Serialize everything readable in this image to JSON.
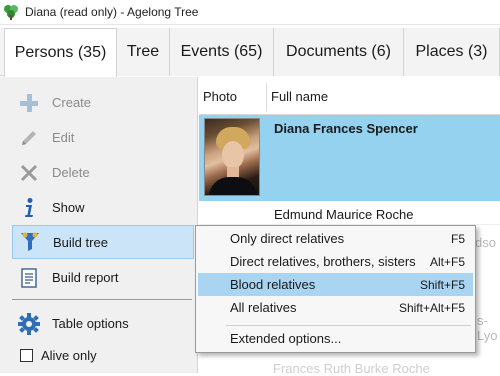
{
  "window": {
    "title": "Diana (read only) - Agelong Tree",
    "icon": "app-tree-icon"
  },
  "tabs": [
    {
      "label": "Persons (35)",
      "active": true
    },
    {
      "label": "Tree"
    },
    {
      "label": "Events (65)"
    },
    {
      "label": "Documents (6)"
    },
    {
      "label": "Places (3)"
    }
  ],
  "sidebar": {
    "items": [
      {
        "label": "Create",
        "icon": "plus-icon",
        "enabled": false
      },
      {
        "label": "Edit",
        "icon": "pencil-icon",
        "enabled": false
      },
      {
        "label": "Delete",
        "icon": "cross-icon",
        "enabled": false
      },
      {
        "label": "Show",
        "icon": "info-icon",
        "enabled": true
      },
      {
        "label": "Build tree",
        "icon": "tree-funnel-icon",
        "enabled": true,
        "selected": true
      },
      {
        "label": "Build report",
        "icon": "report-icon",
        "enabled": true
      }
    ],
    "table_options": {
      "label": "Table options",
      "icon": "gear-icon"
    },
    "alive_only": {
      "label": "Alive only",
      "checked": false
    }
  },
  "grid": {
    "columns": [
      "Photo",
      "Full name"
    ],
    "rows": [
      {
        "name": "Diana Frances Spencer",
        "selected": true,
        "has_photo": true
      },
      {
        "name": "Edmund Maurice Roche"
      }
    ],
    "ghost_texts": [
      "dso",
      "s-Lyo",
      "Frances Ruth Burke Roche"
    ]
  },
  "context_menu": {
    "items": [
      {
        "label": "Only direct relatives",
        "shortcut": "F5"
      },
      {
        "label": "Direct relatives, brothers, sisters",
        "shortcut": "Alt+F5"
      },
      {
        "label": "Blood relatives",
        "shortcut": "Shift+F5",
        "highlighted": true
      },
      {
        "label": "All relatives",
        "shortcut": "Shift+Alt+F5"
      },
      {
        "label": "Extended options...",
        "shortcut": ""
      }
    ]
  },
  "colors": {
    "accent_selected": "#94d2ef",
    "menu_highlight": "#a9d4f2",
    "sidebar_selected": "#cce4f7"
  }
}
